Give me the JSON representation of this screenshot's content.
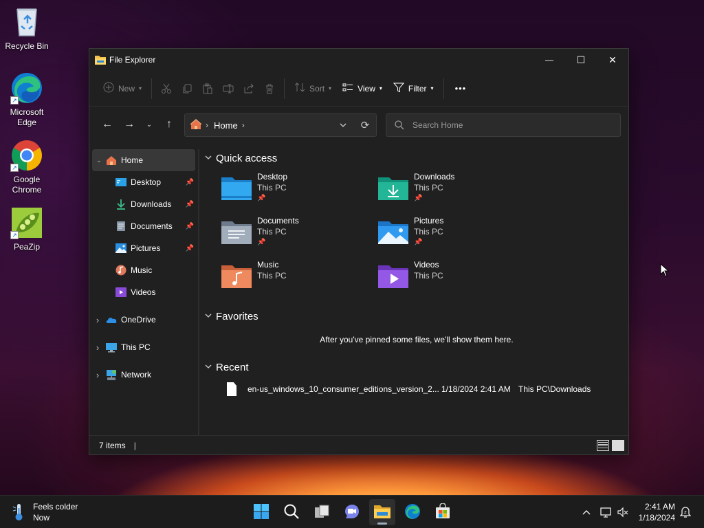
{
  "desktop": {
    "icons": [
      {
        "label": "Recycle Bin",
        "icon": "recycle-bin-icon"
      },
      {
        "label": "Microsoft Edge",
        "icon": "edge-icon"
      },
      {
        "label": "Google Chrome",
        "icon": "chrome-icon"
      },
      {
        "label": "PeaZip",
        "icon": "peazip-icon"
      }
    ]
  },
  "window": {
    "title": "File Explorer",
    "controls": {
      "minimize": "—",
      "maximize": "☐",
      "close": "✕"
    }
  },
  "toolbar": {
    "new_label": "New",
    "sort_label": "Sort",
    "view_label": "View",
    "filter_label": "Filter",
    "more_label": "•••",
    "icons": [
      "cut-icon",
      "copy-icon",
      "paste-icon",
      "rename-icon",
      "share-icon",
      "delete-icon"
    ]
  },
  "navigation": {
    "back": "←",
    "forward": "→",
    "recent": "⌄",
    "up": "↑",
    "address": {
      "location": "Home",
      "separator": "›"
    },
    "refresh": "⟳",
    "search_placeholder": "Search Home"
  },
  "sidebar": {
    "items": [
      {
        "label": "Home",
        "icon": "home-icon",
        "expander": "⌄",
        "selected": true
      },
      {
        "label": "Desktop",
        "icon": "desktop-folder-icon",
        "pinned": true
      },
      {
        "label": "Downloads",
        "icon": "downloads-icon",
        "pinned": true
      },
      {
        "label": "Documents",
        "icon": "documents-icon",
        "pinned": true
      },
      {
        "label": "Pictures",
        "icon": "pictures-icon",
        "pinned": true
      },
      {
        "label": "Music",
        "icon": "music-icon"
      },
      {
        "label": "Videos",
        "icon": "videos-icon"
      },
      {
        "label": "OneDrive",
        "icon": "onedrive-icon",
        "expander": "›"
      },
      {
        "label": "This PC",
        "icon": "this-pc-icon",
        "expander": "›"
      },
      {
        "label": "Network",
        "icon": "network-icon",
        "expander": "›"
      }
    ]
  },
  "quick_access": {
    "header": "Quick access",
    "items": [
      {
        "name": "Desktop",
        "location": "This PC",
        "pinned": true,
        "color": "#1f8fd6"
      },
      {
        "name": "Downloads",
        "location": "This PC",
        "pinned": true,
        "color": "#1aa58a"
      },
      {
        "name": "Documents",
        "location": "This PC",
        "pinned": true,
        "color": "#8a97a8"
      },
      {
        "name": "Pictures",
        "location": "This PC",
        "pinned": true,
        "color": "#2a8fe0"
      },
      {
        "name": "Music",
        "location": "This PC",
        "pinned": false,
        "color": "#e07a4a"
      },
      {
        "name": "Videos",
        "location": "This PC",
        "pinned": false,
        "color": "#8a4ad8"
      }
    ]
  },
  "favorites": {
    "header": "Favorites",
    "empty_message": "After you've pinned some files, we'll show them here."
  },
  "recent": {
    "header": "Recent",
    "files": [
      {
        "name": "en-us_windows_10_consumer_editions_version_2...",
        "date": "1/18/2024 2:41 AM",
        "location": "This PC\\Downloads"
      }
    ]
  },
  "status": {
    "items_count": "7 items",
    "cursor": "|"
  },
  "taskbar": {
    "weather": {
      "line1": "Feels colder",
      "line2": "Now"
    },
    "apps": [
      "start-icon",
      "search-icon",
      "task-view-icon",
      "chat-icon",
      "file-explorer-icon",
      "edge-icon",
      "store-icon"
    ],
    "active_app": "file-explorer-icon",
    "tray": {
      "chevron": "^"
    },
    "clock": {
      "time": "2:41 AM",
      "date": "1/18/2024"
    }
  },
  "colors": {
    "window_bg": "#202020",
    "selected_bg": "#383838",
    "taskbar_bg": "#1c1c1c"
  }
}
